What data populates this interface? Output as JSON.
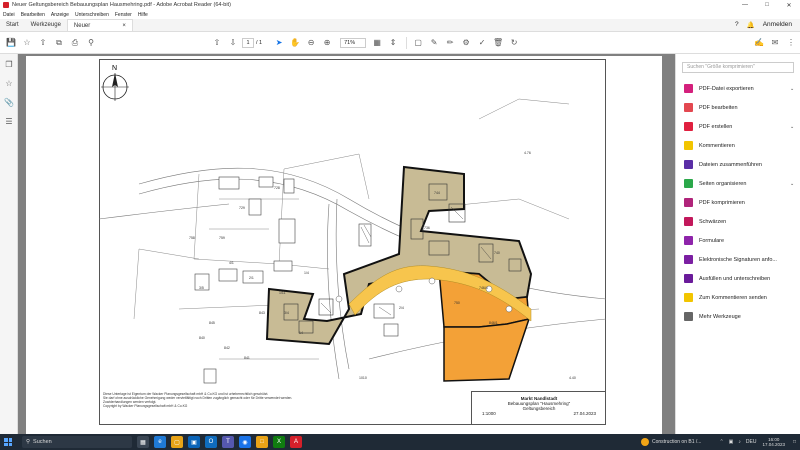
{
  "window": {
    "title": "Neuer Geltungsbereich Bebauungsplan Hausmehring.pdf - Adobe Acrobat Reader (64-bit)"
  },
  "menu": [
    "Datei",
    "Bearbeiten",
    "Anzeige",
    "Unterschreiben",
    "Fenster",
    "Hilfe"
  ],
  "tabs": {
    "home": "Start",
    "tools": "Werkzeuge",
    "doc": "Neuer Geltungsber...",
    "doc_close": "×"
  },
  "header": {
    "login": "Anmelden"
  },
  "toolbar": {
    "page_current": "1",
    "page_total": "/ 1",
    "zoom": "71%"
  },
  "plan": {
    "north": "N",
    "numbers": [
      "4.76",
      "4.40",
      "728",
      "740",
      "744",
      "736",
      "746/4",
      "750",
      "1010",
      "729",
      "759",
      "758",
      "840",
      "842",
      "841",
      "845",
      "843",
      "846/1",
      "4/1",
      "2/1",
      "14",
      "1/11",
      "1/4",
      "3/5",
      "3/4",
      "2/4"
    ]
  },
  "titleblock": {
    "line1": "Markt Nandlstadt",
    "line2": "Bebauungsplan \"Hausmehring\"",
    "line3": "Geltungsbereich",
    "scale": "1:1000",
    "date": "27.04.2023"
  },
  "notes": {
    "n1": "Diese Unterlage ist Eigentum der Wacker Planungsgesellschaft mbH & Co.KG und ist urheberrechtlich geschützt.",
    "n2": "Sie darf ohne ausdrückliche Genehmigung weder vervielfältigt noch Dritten zugänglich gemacht oder für Dritte verwendet werden.",
    "n3": "Zuwiderhandlungen werden verfolgt.",
    "n4": "Copyright by Wacker Planungsgesellschaft mbH & Co.KG"
  },
  "rightpane": {
    "search_placeholder": "Suchen \"Größe komprimieren\"",
    "tools": [
      {
        "label": "PDF-Datei exportieren",
        "color": "#d4207c",
        "chev": true
      },
      {
        "label": "PDF bearbeiten",
        "color": "#e34850",
        "chev": false
      },
      {
        "label": "PDF erstellen",
        "color": "#e0203f",
        "chev": true
      },
      {
        "label": "Kommentieren",
        "color": "#f2c500",
        "chev": false
      },
      {
        "label": "Dateien zusammenführen",
        "color": "#5a2ea6",
        "chev": false
      },
      {
        "label": "Seiten organisieren",
        "color": "#2ba84a",
        "chev": true
      },
      {
        "label": "PDF komprimieren",
        "color": "#b0247a",
        "chev": false
      },
      {
        "label": "Schwärzen",
        "color": "#c2185b",
        "chev": false
      },
      {
        "label": "Formulare",
        "color": "#8e24aa",
        "chev": false
      },
      {
        "label": "Elektronische Signaturen anfo...",
        "color": "#7b1fa2",
        "chev": false
      },
      {
        "label": "Ausfüllen und unterschreiben",
        "color": "#6a1b9a",
        "chev": false
      },
      {
        "label": "Zum Kommentieren senden",
        "color": "#f2c500",
        "chev": false
      },
      {
        "label": "Mehr Werkzeuge",
        "color": "#666666",
        "chev": false
      }
    ]
  },
  "taskbar": {
    "search": "Suchen",
    "weather": "Construction on B1 /...",
    "lang": "DEU",
    "time": "16:00",
    "date": "17.04.2023"
  }
}
